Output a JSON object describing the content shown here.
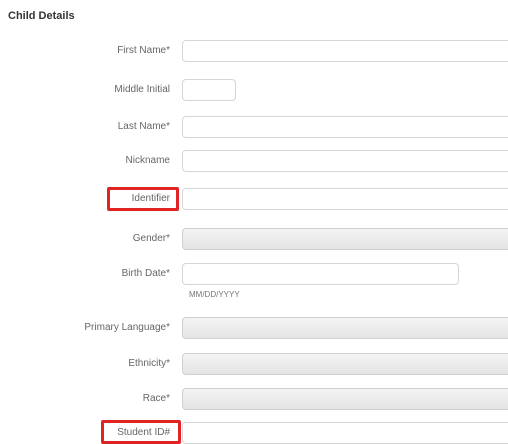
{
  "section": {
    "title": "Child Details"
  },
  "fields": {
    "first_name": {
      "label": "First Name*"
    },
    "middle_initial": {
      "label": "Middle Initial"
    },
    "last_name": {
      "label": "Last Name*"
    },
    "nickname": {
      "label": "Nickname"
    },
    "identifier": {
      "label": "Identifier"
    },
    "gender": {
      "label": "Gender*"
    },
    "birth_date": {
      "label": "Birth Date*",
      "hint": "MM/DD/YYYY"
    },
    "primary_language": {
      "label": "Primary Language*"
    },
    "ethnicity": {
      "label": "Ethnicity*"
    },
    "race": {
      "label": "Race*"
    },
    "student_id": {
      "label": "Student ID#"
    }
  },
  "colors": {
    "highlight": "#e02424",
    "select_fill": "#e8e8e8",
    "field_border": "#d6d6d6"
  }
}
